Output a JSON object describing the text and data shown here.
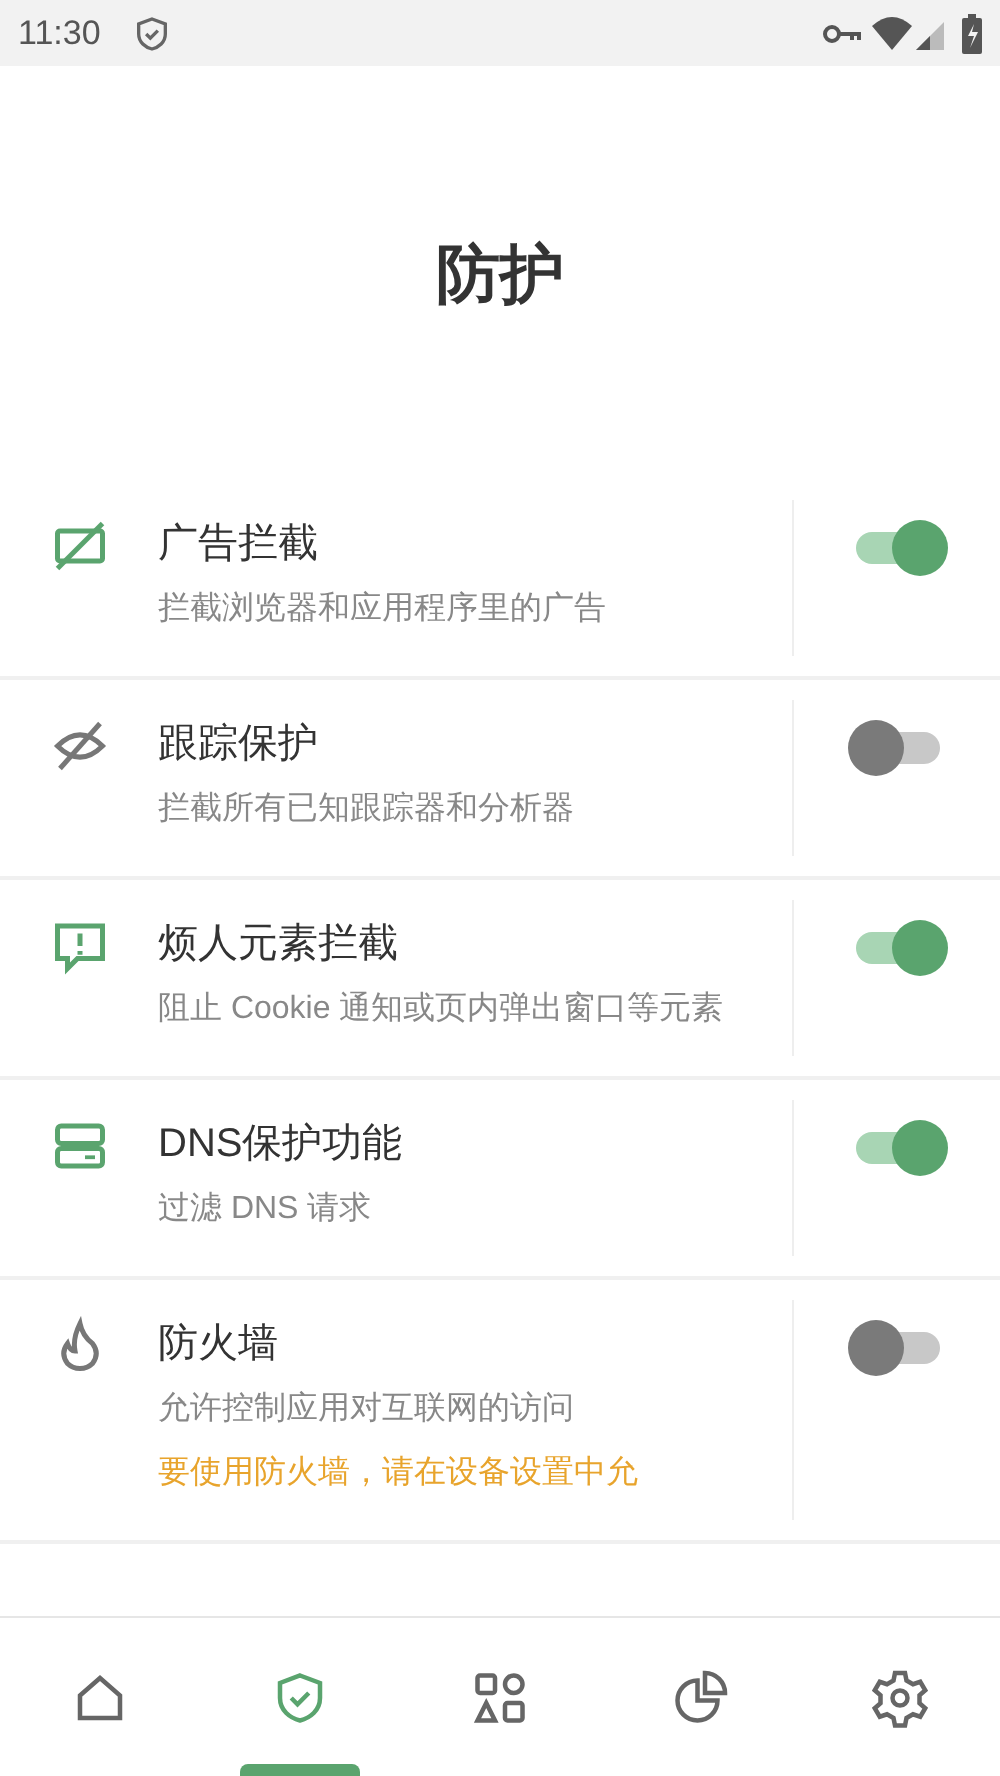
{
  "status_bar": {
    "time": "11:30"
  },
  "title": "防护",
  "features": [
    {
      "title": "广告拦截",
      "description": "拦截浏览器和应用程序里的广告",
      "enabled": true
    },
    {
      "title": "跟踪保护",
      "description": "拦截所有已知跟踪器和分析器",
      "enabled": false
    },
    {
      "title": "烦人元素拦截",
      "description": "阻止 Cookie 通知或页内弹出窗口等元素",
      "enabled": true
    },
    {
      "title": "DNS保护功能",
      "description": "过滤 DNS 请求",
      "enabled": true
    },
    {
      "title": "防火墙",
      "description": "允许控制应用对互联网的访问",
      "warning": "要使用防火墙，请在设备设置中允",
      "enabled": false
    }
  ],
  "nav": [
    {
      "selected": false
    },
    {
      "selected": true
    },
    {
      "selected": false
    },
    {
      "selected": false
    },
    {
      "selected": false
    }
  ]
}
